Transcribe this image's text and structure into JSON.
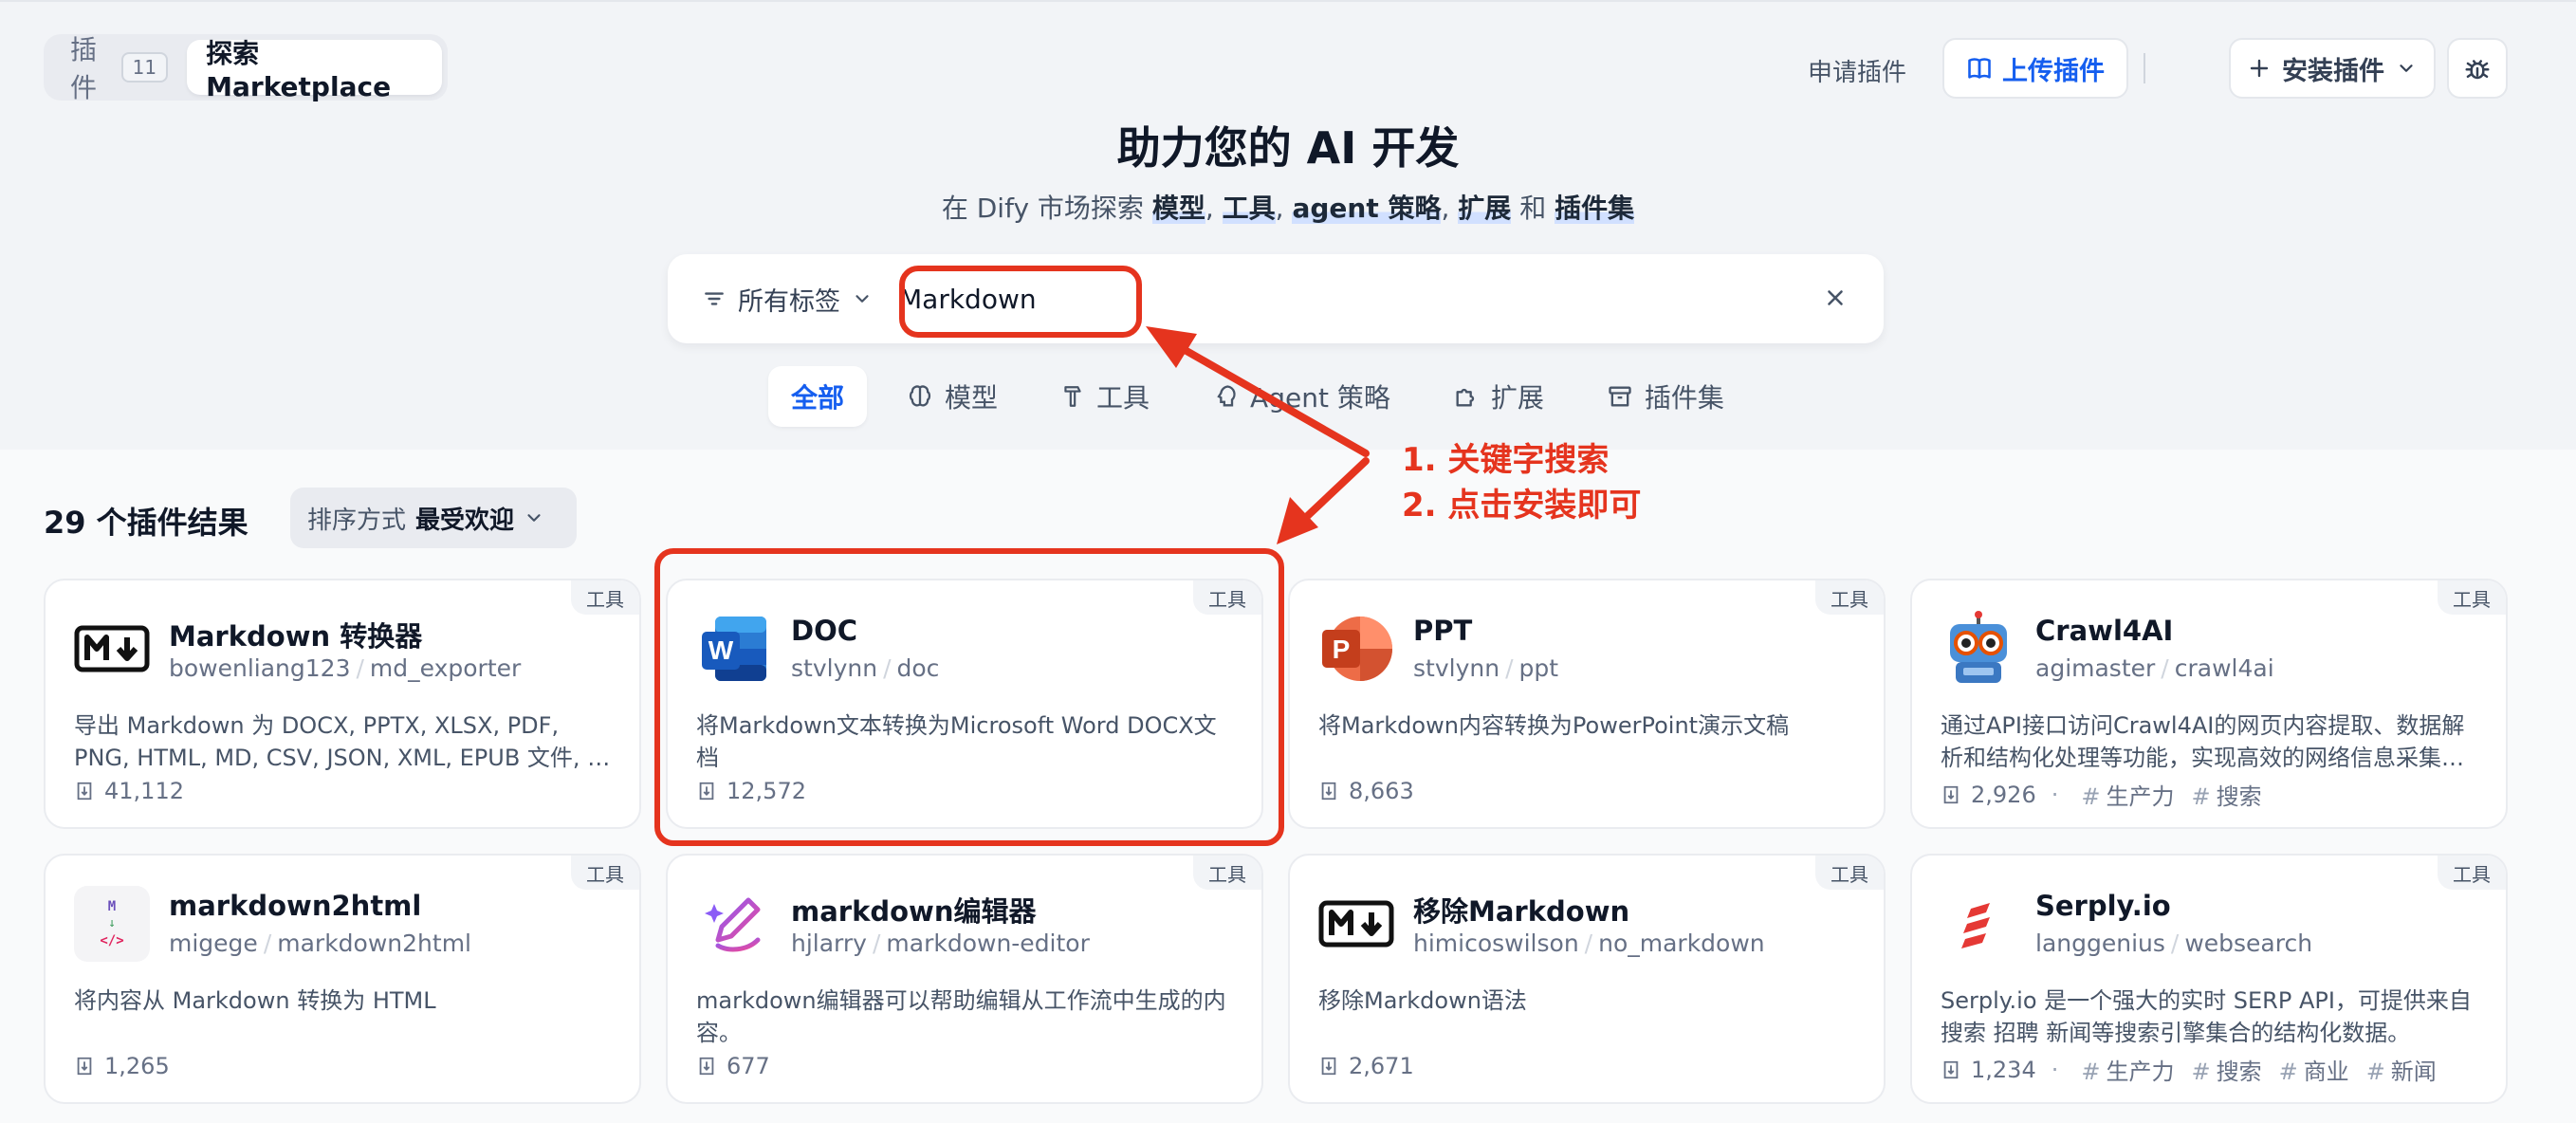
{
  "tabs": {
    "plugins_label": "插件",
    "plugins_count": "11",
    "marketplace_label": "探索 Marketplace"
  },
  "header": {
    "apply_label": "申请插件",
    "upload_label": "上传插件",
    "install_label": "安装插件"
  },
  "hero": {
    "title": "助力您的 AI 开发",
    "sub_prefix": "在 Dify 市场探索 ",
    "sub_models": "模型",
    "comma": ", ",
    "sub_tools": "工具",
    "sub_agent": "agent 策略",
    "sub_ext": "扩展",
    "sub_and": " 和 ",
    "sub_bundles": "插件集"
  },
  "search": {
    "tag_filter_label": "所有标签",
    "value": "Markdown"
  },
  "categories": [
    {
      "label": "全部",
      "icon": "none"
    },
    {
      "label": "模型",
      "icon": "brain-icon"
    },
    {
      "label": "工具",
      "icon": "hammer-icon"
    },
    {
      "label": "Agent 策略",
      "icon": "agent-icon"
    },
    {
      "label": "扩展",
      "icon": "puzzle-icon"
    },
    {
      "label": "插件集",
      "icon": "archive-icon"
    }
  ],
  "results": {
    "count_label": "29 个插件结果",
    "sort_prefix": "排序方式",
    "sort_value": "最受欢迎"
  },
  "cards": [
    {
      "badge": "工具",
      "name": "Markdown 转换器",
      "org": "bowenliang123",
      "repo": "md_exporter",
      "desc": "导出 Markdown 为 DOCX, PPTX, XLSX, PDF, PNG, HTML, MD, CSV, JSON, XML, EPUB 文件, 并将代码块提取为文件",
      "installs": "41,112",
      "tags": []
    },
    {
      "badge": "工具",
      "name": "DOC",
      "org": "stvlynn",
      "repo": "doc",
      "desc": "将Markdown文本转换为Microsoft Word DOCX文档",
      "installs": "12,572",
      "tags": []
    },
    {
      "badge": "工具",
      "name": "PPT",
      "org": "stvlynn",
      "repo": "ppt",
      "desc": "将Markdown内容转换为PowerPoint演示文稿",
      "installs": "8,663",
      "tags": []
    },
    {
      "badge": "工具",
      "name": "Crawl4AI",
      "org": "agimaster",
      "repo": "crawl4ai",
      "desc": "通过API接口访问Crawl4AI的网页内容提取、数据解析和结构化处理等功能，实现高效的网络信息采集与整理",
      "installs": "2,926",
      "tags": [
        "生产力",
        "搜索"
      ]
    },
    {
      "badge": "工具",
      "name": "markdown2html",
      "org": "migege",
      "repo": "markdown2html",
      "desc": "将内容从 Markdown 转换为 HTML",
      "installs": "1,265",
      "tags": []
    },
    {
      "badge": "工具",
      "name": "markdown编辑器",
      "org": "hjlarry",
      "repo": "markdown-editor",
      "desc": "markdown编辑器可以帮助编辑从工作流中生成的内容。",
      "installs": "677",
      "tags": []
    },
    {
      "badge": "工具",
      "name": "移除Markdown",
      "org": "himicoswilson",
      "repo": "no_markdown",
      "desc": "移除Markdown语法",
      "installs": "2,671",
      "tags": []
    },
    {
      "badge": "工具",
      "name": "Serply.io",
      "org": "langgenius",
      "repo": "websearch",
      "desc": "Serply.io 是一个强大的实时 SERP API，可提供来自搜索 招聘 新闻等搜索引擎集合的结构化数据。",
      "installs": "1,234",
      "tags": [
        "生产力",
        "搜索",
        "商业",
        "新闻"
      ]
    }
  ],
  "annotation": {
    "step1": "1. 关键字搜索",
    "step2": "2. 点击安装即可",
    "color": "#e5341e"
  }
}
